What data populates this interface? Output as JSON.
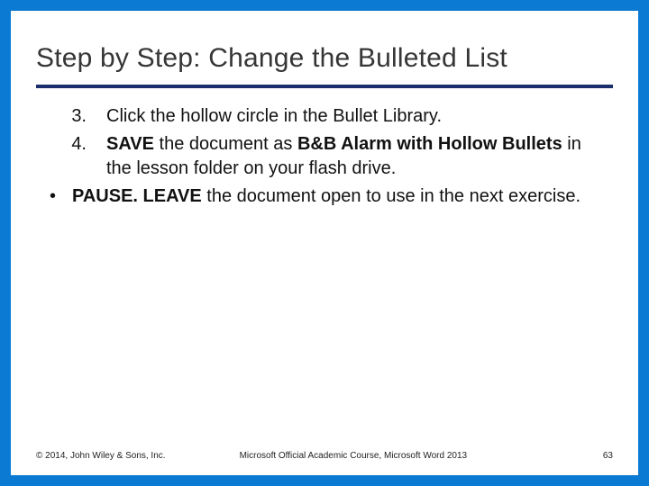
{
  "title": "Step by Step: Change the Bulleted List",
  "steps": [
    {
      "num": "3.",
      "pre": "",
      "bold1": "",
      "mid": "Click the hollow circle in the Bullet Library.",
      "bold2": "",
      "post": ""
    },
    {
      "num": "4.",
      "pre": "",
      "bold1": "SAVE",
      "mid": " the document as ",
      "bold2": "B&B Alarm with Hollow Bullets",
      "post": " in the lesson folder on your flash drive."
    }
  ],
  "bullet": {
    "bold": "PAUSE. LEAVE",
    "rest": " the document open to use in the next exercise."
  },
  "footer": {
    "copyright": "© 2014, John Wiley & Sons, Inc.",
    "course": "Microsoft Official Academic Course, Microsoft Word 2013",
    "page": "63"
  }
}
